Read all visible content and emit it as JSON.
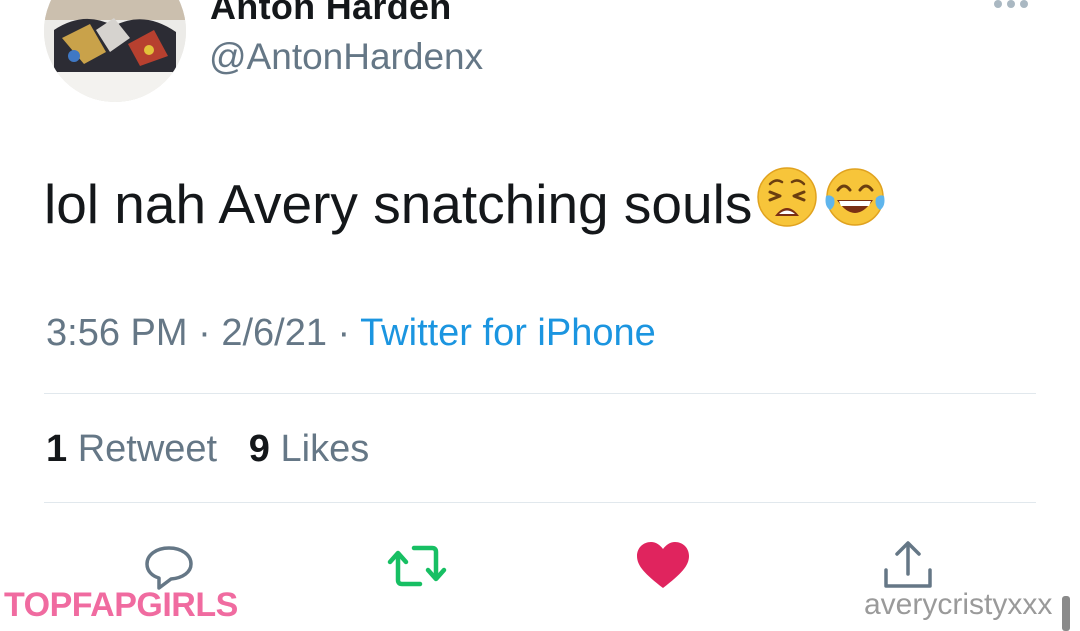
{
  "tweet": {
    "display_name": "Anton Harden",
    "handle": "@AntonHardenx",
    "text": "lol nah Avery snatching souls",
    "emojis": [
      "weary-face-icon",
      "tears-of-joy-icon"
    ],
    "time": "3:56 PM",
    "date": "2/6/21",
    "separator": " · ",
    "source": "Twitter for iPhone",
    "retweets": {
      "count": "1",
      "label": "Retweet"
    },
    "likes": {
      "count": "9",
      "label": "Likes"
    }
  },
  "actions": [
    "reply-icon",
    "retweet-icon",
    "like-icon",
    "share-icon"
  ],
  "colors": {
    "text": "#14171a",
    "muted": "#657786",
    "link": "#1b95e0",
    "retweet": "#17bf63",
    "like": "#e0245e",
    "divider": "#e1e8ed"
  },
  "watermarks": {
    "left": "TOPFAPGIRLS",
    "right": "averycristyxxx"
  }
}
